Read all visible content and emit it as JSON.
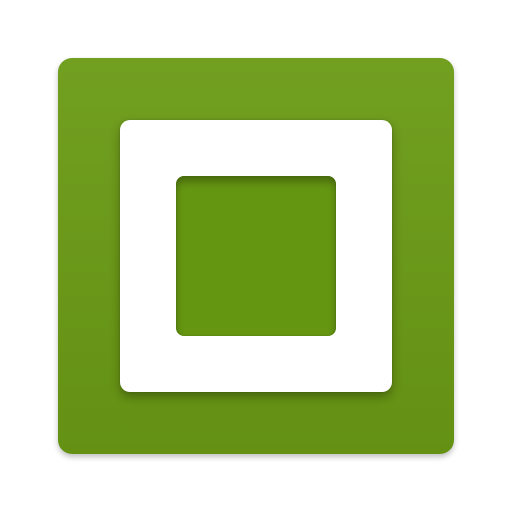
{
  "icon": {
    "name": "square-frame-icon",
    "colors": {
      "background": "#ffffff",
      "tile": "#6a9a14",
      "frame": "#ffffff",
      "inner": "#659612"
    }
  }
}
